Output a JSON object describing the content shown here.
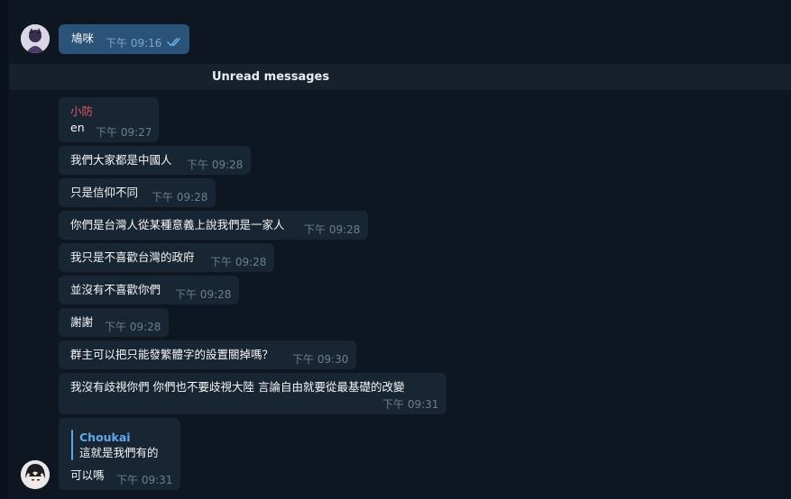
{
  "outgoing": {
    "text": "鳩咪",
    "time": "下午 09:16"
  },
  "unread": {
    "label": "Unread messages"
  },
  "incoming": {
    "sender": "小防",
    "messages": [
      {
        "text": "en",
        "time": "下午 09:27"
      },
      {
        "text": "我們大家都是中國人",
        "time": "下午 09:28"
      },
      {
        "text": "只是信仰不同",
        "time": "下午 09:28"
      },
      {
        "text": "你們是台灣人從某種意義上說我們是一家人",
        "time": "下午 09:28"
      },
      {
        "text": "我只是不喜歡台灣的政府",
        "time": "下午 09:28"
      },
      {
        "text": "並沒有不喜歡你們",
        "time": "下午 09:28"
      },
      {
        "text": "謝謝",
        "time": "下午 09:28"
      },
      {
        "text": "群主可以把只能發繁體字的設置關掉嗎？",
        "time": "下午 09:30"
      },
      {
        "text": "我沒有歧視你們 你們也不要歧視大陸 言論自由就要從最基礎的改變",
        "time": "下午 09:31"
      }
    ],
    "last": {
      "reply_name": "Choukai",
      "reply_text": "這就是我們有的",
      "text": "可以嗎",
      "time": "下午 09:31"
    }
  },
  "colors": {
    "background": "#0e1621",
    "bubble_in": "#182533",
    "bubble_out": "#2b5278",
    "sender": "#e0586a",
    "reply_accent": "#62a8ea",
    "ticks": "#6ab2f2"
  }
}
